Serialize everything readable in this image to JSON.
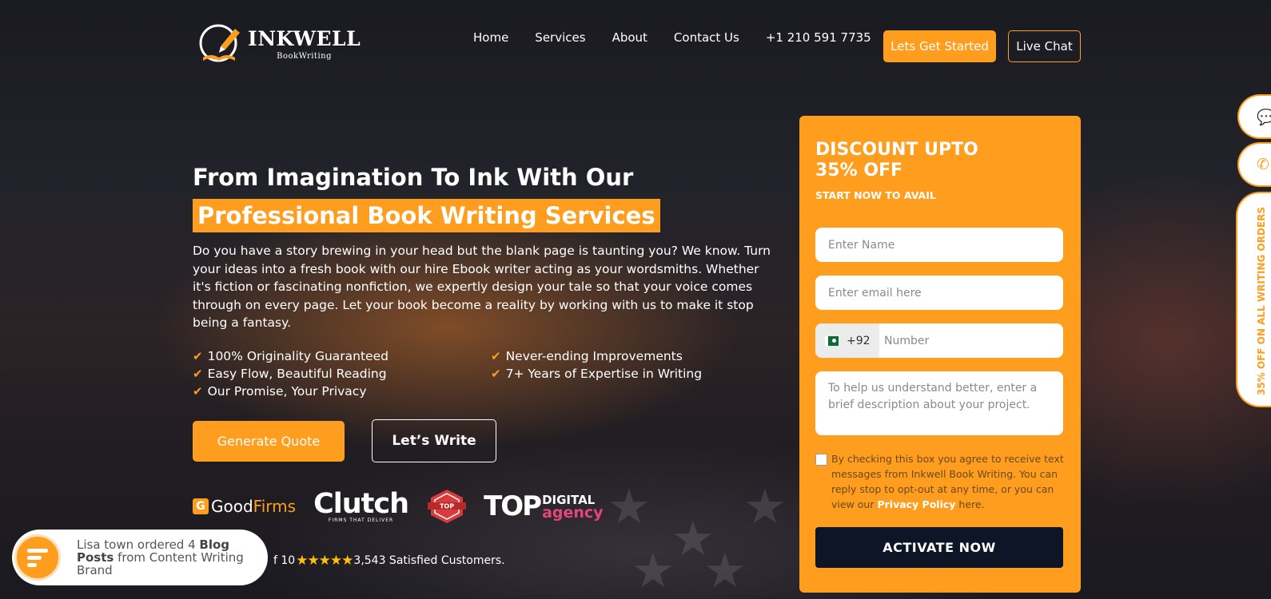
{
  "header": {
    "logo_name": "INKWELL",
    "logo_sub": "BookWriting",
    "nav": [
      "Home",
      "Services",
      "About",
      "Contact Us"
    ],
    "phone": "+1 210 591 7735",
    "cta_start": "Lets Get Started",
    "cta_chat": "Live Chat"
  },
  "hero": {
    "title_line1": "From Imagination To Ink With Our",
    "title_line2": "Professional Book Writing Services",
    "description": "Do you have a story brewing in your head but the blank page is taunting you? We know. Turn your ideas into a fresh book with our hire Ebook writer acting as your wordsmiths. Whether it's fiction or fascinating nonfiction, we expertly design your tale so that your voice comes through on every page. Let your book become a reality by working with us to make it stop being a fantasy.",
    "features": [
      "100% Originality Guaranteed",
      "Never-ending Improvements",
      "Easy Flow, Beautiful Reading",
      "7+ Years of Expertise in Writing",
      "Our Promise, Your Privacy"
    ],
    "btn_quote": "Generate Quote",
    "btn_write": "Let’s Write"
  },
  "badges": {
    "goodfirms_good": "Good",
    "goodfirms_firms": "Firms",
    "clutch": "Clutch",
    "clutch_sub": "FIRMS THAT DELIVER",
    "top_label": "TOP",
    "topdigital_top": "TOP",
    "topdigital_digital": "DIGITAL",
    "topdigital_agency": "agency"
  },
  "rating": {
    "prefix": "f 10",
    "stars": "★★★★★",
    "customers": "3,543 Satisfied Customers."
  },
  "toast": {
    "before": "Lisa town ordered 4 ",
    "bold": "Blog Posts",
    "after": " from Content Writing Brand"
  },
  "form": {
    "heading": "DISCOUNT UPTO 35% OFF",
    "subheading": "START NOW TO AVAIL",
    "name_placeholder": "Enter Name",
    "email_placeholder": "Enter email here",
    "country_code": "+92",
    "number_placeholder": "Number",
    "desc_placeholder": "To help us understand better, enter a brief description about your project.",
    "consent_before": "By checking this box you agree to receive text messages from Inkwell Book Writing. You can reply stop to opt-out at any time, or you can view our ",
    "consent_link": "Privacy Policy",
    "consent_after": " here.",
    "submit": "ACTIVATE NOW"
  },
  "rail": {
    "offer": "35% OFF ON ALL WRITING ORDERS"
  },
  "colors": {
    "accent": "#ff9d1f",
    "dark_button": "#0d1526"
  }
}
